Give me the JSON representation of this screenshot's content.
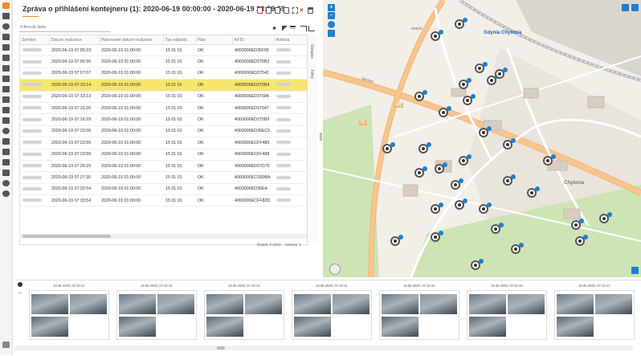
{
  "report": {
    "title": "Zpráva o přihlášení kontejneru (1): 2020-06-19 00:00:00 - 2020-06-19 23:59:59",
    "filter_placeholder": "Filtrovat data",
    "columns": [
      "Symbol",
      "Datum realizace",
      "Plánované datum realizace",
      "Typ odpadu",
      "Plán",
      "RFID",
      "Adresa"
    ],
    "rows": [
      [
        "",
        "2020-06-19 07:05:23",
        "2020-06-19 01:00:00",
        "15 01 01",
        "OK",
        "4000000ED35F05",
        ""
      ],
      [
        "",
        "2020-06-19 07:06:56",
        "2020-06-19 01:00:00",
        "15 01 01",
        "OK",
        "4000000ED375B2",
        ""
      ],
      [
        "",
        "2020-06-19 07:07:07",
        "2020-06-19 01:00:00",
        "15 01 01",
        "OK",
        "4000000ED37542",
        ""
      ],
      [
        "",
        "2020-06-19 07:10:14",
        "2020-06-19 01:00:00",
        "15 01 01",
        "OK",
        "4000000ED375B4",
        ""
      ],
      [
        "",
        "2020-06-19 07:13:13",
        "2020-06-19 01:00:00",
        "15 01 01",
        "OK",
        "4000000ED37584",
        ""
      ],
      [
        "",
        "2020-06-19 07:15:20",
        "2020-06-19 01:00:00",
        "15 01 01",
        "OK",
        "4000000ED37547",
        ""
      ],
      [
        "",
        "2020-06-19 07:16:29",
        "2020-06-19 01:00:00",
        "15 01 01",
        "OK",
        "4000000ED375B9",
        ""
      ],
      [
        "",
        "2020-06-19 07:23:05",
        "2020-06-19 01:00:00",
        "15 01 01",
        "OK",
        "4000000ED36EC5",
        ""
      ],
      [
        "",
        "2020-06-19 07:23:55",
        "2020-06-19 01:00:00",
        "15 01 01",
        "OK",
        "4000000ECFF485",
        ""
      ],
      [
        "",
        "2020-06-19 07:23:59",
        "2020-06-19 01:00:00",
        "15 01 01",
        "OK",
        "4000000ECFF488",
        ""
      ],
      [
        "",
        "2020-06-19 07:26:29",
        "2020-06-19 01:00:00",
        "15 01 01",
        "OK",
        "4000000ED37D75",
        ""
      ],
      [
        "",
        "2020-06-19 07:27:30",
        "2020-06-19 01:00:00",
        "15 01 01",
        "OK",
        "4000000ECS50BA",
        ""
      ],
      [
        "",
        "2020-06-19 07:32:54",
        "2020-06-19 01:00:00",
        "15 01 01",
        "OK",
        "4000000ED36EA",
        ""
      ],
      [
        "",
        "2020-06-19 07:33:54",
        "2020-06-19 01:00:00",
        "15 01 01",
        "OK",
        "4000000ECFF82D",
        ""
      ]
    ],
    "highlighted_row": 3,
    "side_tabs": [
      "Sloupce",
      "Filtry"
    ],
    "footer_rows": "Řádek: 0 (000)",
    "footer_pages": "Stránky: 1"
  },
  "map": {
    "labels": {
      "gdynia": "Gdynia Chylonia",
      "chylonia": "Chylonia",
      "road_468": "468",
      "road_56": "56",
      "street_morska": "Morska",
      "street_d8020": "D8020"
    }
  },
  "gallery": {
    "timestamps": [
      "19.06.2020, 07:10:11",
      "19.06.2020, 07:10:12",
      "19.06.2020, 07:10:13",
      "19.06.2020, 07:10:14",
      "19.06.2020, 07:10:15",
      "19.06.2020, 07:10:16",
      "19.06.2020, 07:10:17"
    ]
  },
  "colors": {
    "accent": "#f08a24",
    "highlight_row": "#f5e66f",
    "map_marker_badge": "#1f7fd1",
    "map_bg": "#f2efe9"
  }
}
